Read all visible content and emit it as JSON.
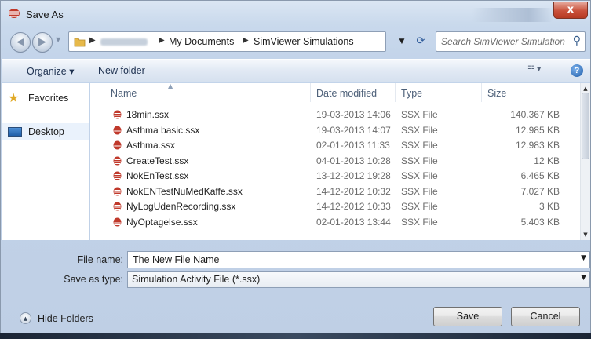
{
  "window": {
    "title": "Save As",
    "close_label": "x"
  },
  "address_bar": {
    "crumbs": [
      "My Documents",
      "SimViewer Simulations"
    ]
  },
  "search": {
    "placeholder": "Search SimViewer Simulations"
  },
  "toolbar": {
    "organize_label": "Organize ▾",
    "new_folder_label": "New folder"
  },
  "nav_pane": {
    "items": [
      {
        "label": "Favorites",
        "icon": "star-icon"
      },
      {
        "label": "Desktop",
        "icon": "desktop-icon"
      }
    ]
  },
  "file_list": {
    "columns": [
      "Name",
      "Date modified",
      "Type",
      "Size"
    ],
    "files": [
      {
        "name": "18min.ssx",
        "date": "19-03-2013 14:06",
        "type": "SSX File",
        "size": "140.367 KB"
      },
      {
        "name": "Asthma basic.ssx",
        "date": "19-03-2013 14:07",
        "type": "SSX File",
        "size": "12.985 KB"
      },
      {
        "name": "Asthma.ssx",
        "date": "02-01-2013 11:33",
        "type": "SSX File",
        "size": "12.983 KB"
      },
      {
        "name": "CreateTest.ssx",
        "date": "04-01-2013 10:28",
        "type": "SSX File",
        "size": "12 KB"
      },
      {
        "name": "NokEnTest.ssx",
        "date": "13-12-2012 19:28",
        "type": "SSX File",
        "size": "6.465 KB"
      },
      {
        "name": "NokENTestNuMedKaffe.ssx",
        "date": "14-12-2012 10:32",
        "type": "SSX File",
        "size": "7.027 KB"
      },
      {
        "name": "NyLogUdenRecording.ssx",
        "date": "14-12-2012 10:33",
        "type": "SSX File",
        "size": "3 KB"
      },
      {
        "name": "NyOptagelse.ssx",
        "date": "02-01-2013 13:44",
        "type": "SSX File",
        "size": "5.403 KB"
      }
    ]
  },
  "form": {
    "file_name_label": "File name:",
    "file_name_value": "The New File Name",
    "save_type_label": "Save as type:",
    "save_type_value": "Simulation Activity File (*.ssx)"
  },
  "footer": {
    "hide_folders_label": "Hide Folders",
    "save_label": "Save",
    "cancel_label": "Cancel"
  },
  "colors": {
    "accent": "#2f5c9a",
    "close_button": "#c9503a",
    "file_icon": "#c0392b"
  }
}
